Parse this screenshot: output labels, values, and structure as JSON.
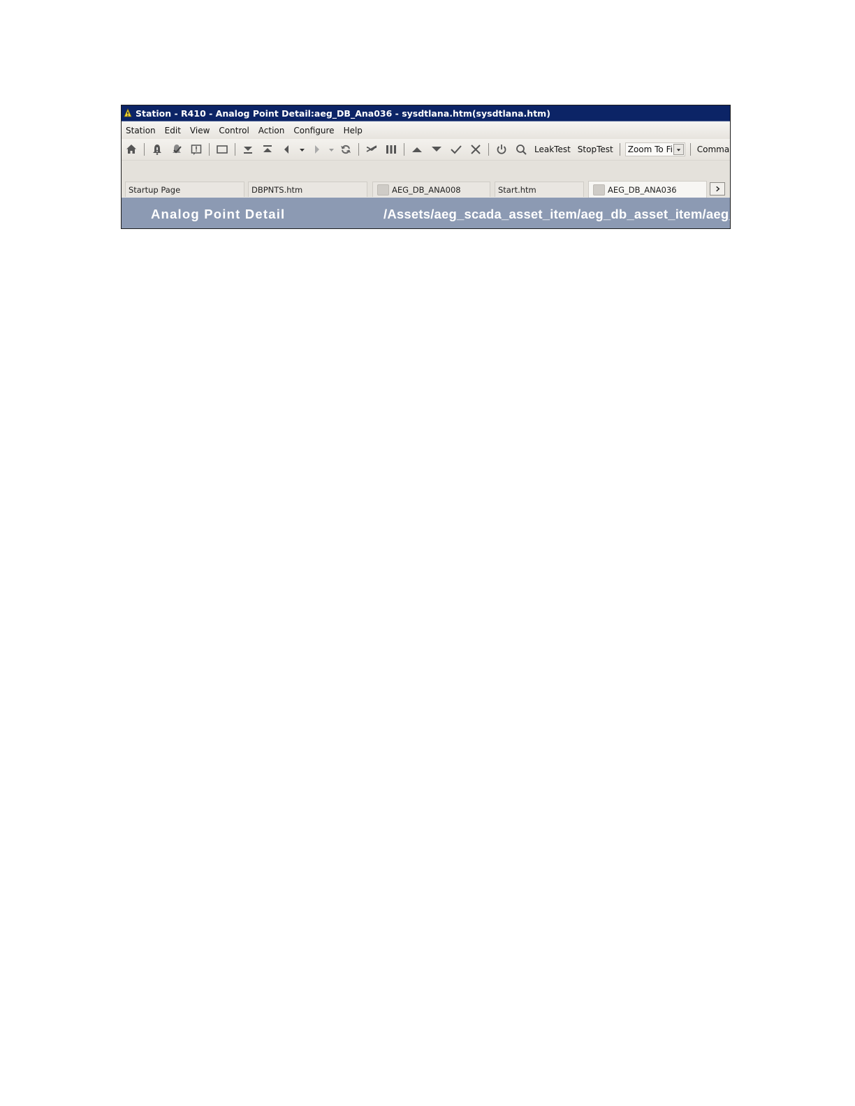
{
  "window": {
    "title": "Station - R410 - Analog Point Detail:aeg_DB_Ana036 - sysdtlana.htm(sysdtlana.htm)"
  },
  "menu": [
    "Station",
    "Edit",
    "View",
    "Control",
    "Action",
    "Configure",
    "Help"
  ],
  "toolbar": {
    "leaktest_label": "LeakTest",
    "stoptest_label": "StopTest",
    "zoom_value": "Zoom To Fi",
    "command_label": "Comman"
  },
  "tabs": [
    {
      "label": "Startup Page",
      "has_icon": false,
      "active": false
    },
    {
      "label": "DBPNTS.htm",
      "has_icon": false,
      "active": false
    },
    {
      "label": "AEG_DB_ANA008",
      "has_icon": true,
      "active": false
    },
    {
      "label": "Start.htm",
      "has_icon": false,
      "active": false
    },
    {
      "label": "AEG_DB_ANA036",
      "has_icon": true,
      "active": true
    }
  ],
  "detail": {
    "title": "Analog Point Detail",
    "path": "/Assets/aeg_scada_asset_item/aeg_db_asset_item/aeg_"
  },
  "colors": {
    "titlebar": "#0c2466",
    "detail_header": "#8c9ab3",
    "chrome": "#ece9e4"
  }
}
